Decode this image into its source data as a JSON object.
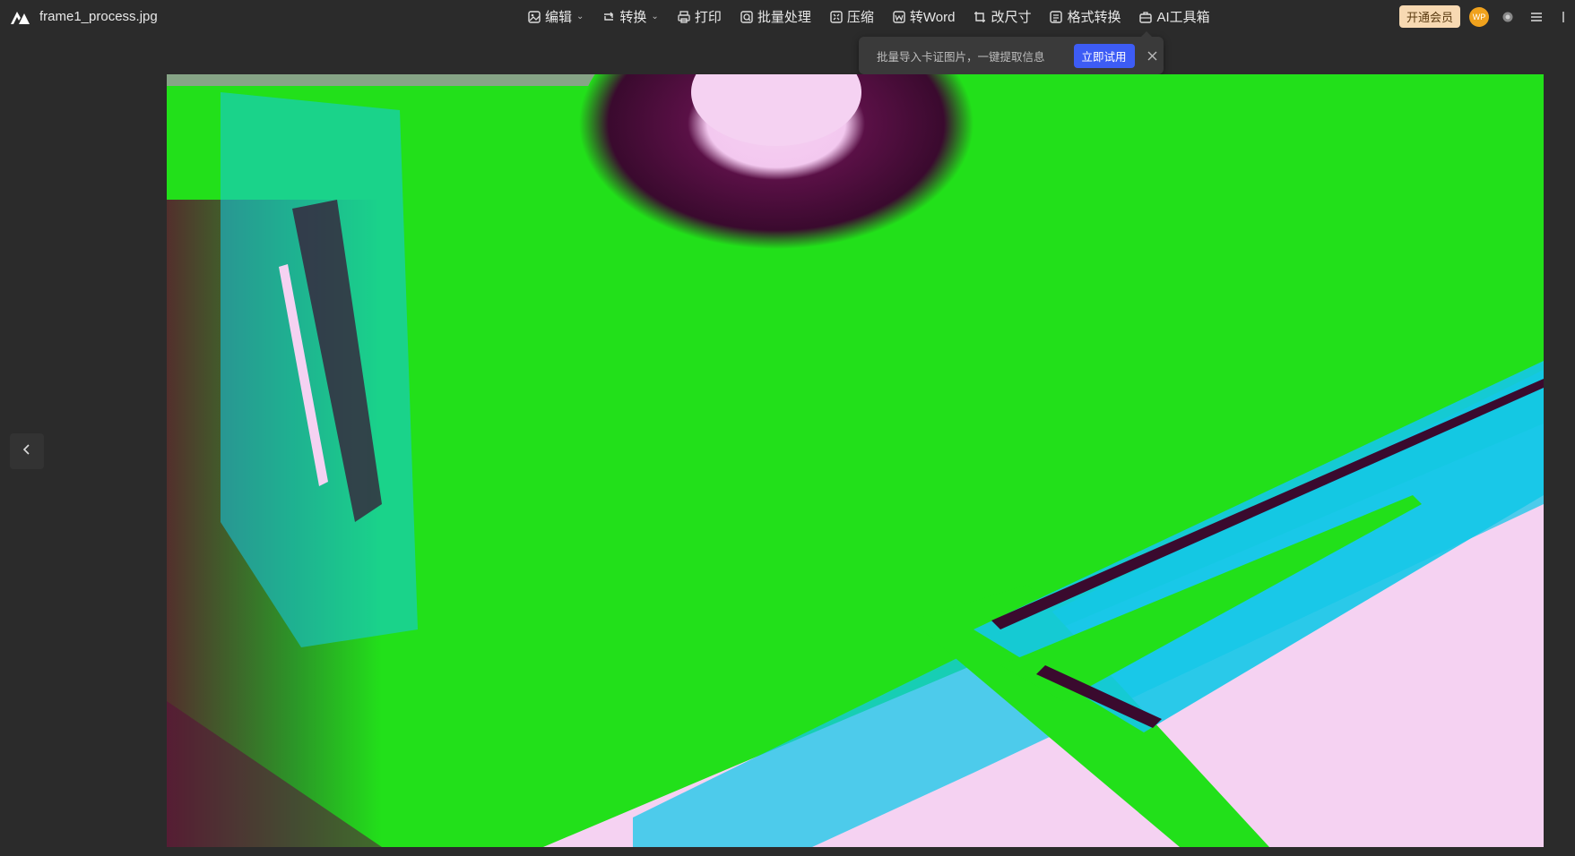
{
  "app": {
    "file_name": "frame1_process.jpg",
    "logo_icon": "app-logo-icon"
  },
  "toolbar": {
    "items": [
      {
        "label": "编辑",
        "icon": "edit-image-icon",
        "dropdown": true
      },
      {
        "label": "转换",
        "icon": "rotate-convert-icon",
        "dropdown": true
      },
      {
        "label": "打印",
        "icon": "printer-icon",
        "dropdown": false
      },
      {
        "label": "批量处理",
        "icon": "batch-process-icon",
        "dropdown": false
      },
      {
        "label": "压缩",
        "icon": "compress-icon",
        "dropdown": false
      },
      {
        "label": "转Word",
        "icon": "to-word-icon",
        "dropdown": false
      },
      {
        "label": "改尺寸",
        "icon": "resize-icon",
        "dropdown": false
      },
      {
        "label": "格式转换",
        "icon": "format-convert-icon",
        "dropdown": false
      },
      {
        "label": "AI工具箱",
        "icon": "ai-toolbox-icon",
        "dropdown": false
      }
    ]
  },
  "header_right": {
    "vip_label": "开通会员",
    "avatar_text": "WP"
  },
  "popup": {
    "text": "批量导入卡证图片，一键提取信息",
    "button_label": "立即试用"
  },
  "colors": {
    "background": "#2b2b2b",
    "accent": "#3d5cf5",
    "vip": "#f7d9b2",
    "avatar": "#f0a21d",
    "image_green": "#22e01a",
    "image_cyan": "#14c8e8",
    "image_pink": "#f5d2f2",
    "image_maroon": "#5a0f3a"
  }
}
